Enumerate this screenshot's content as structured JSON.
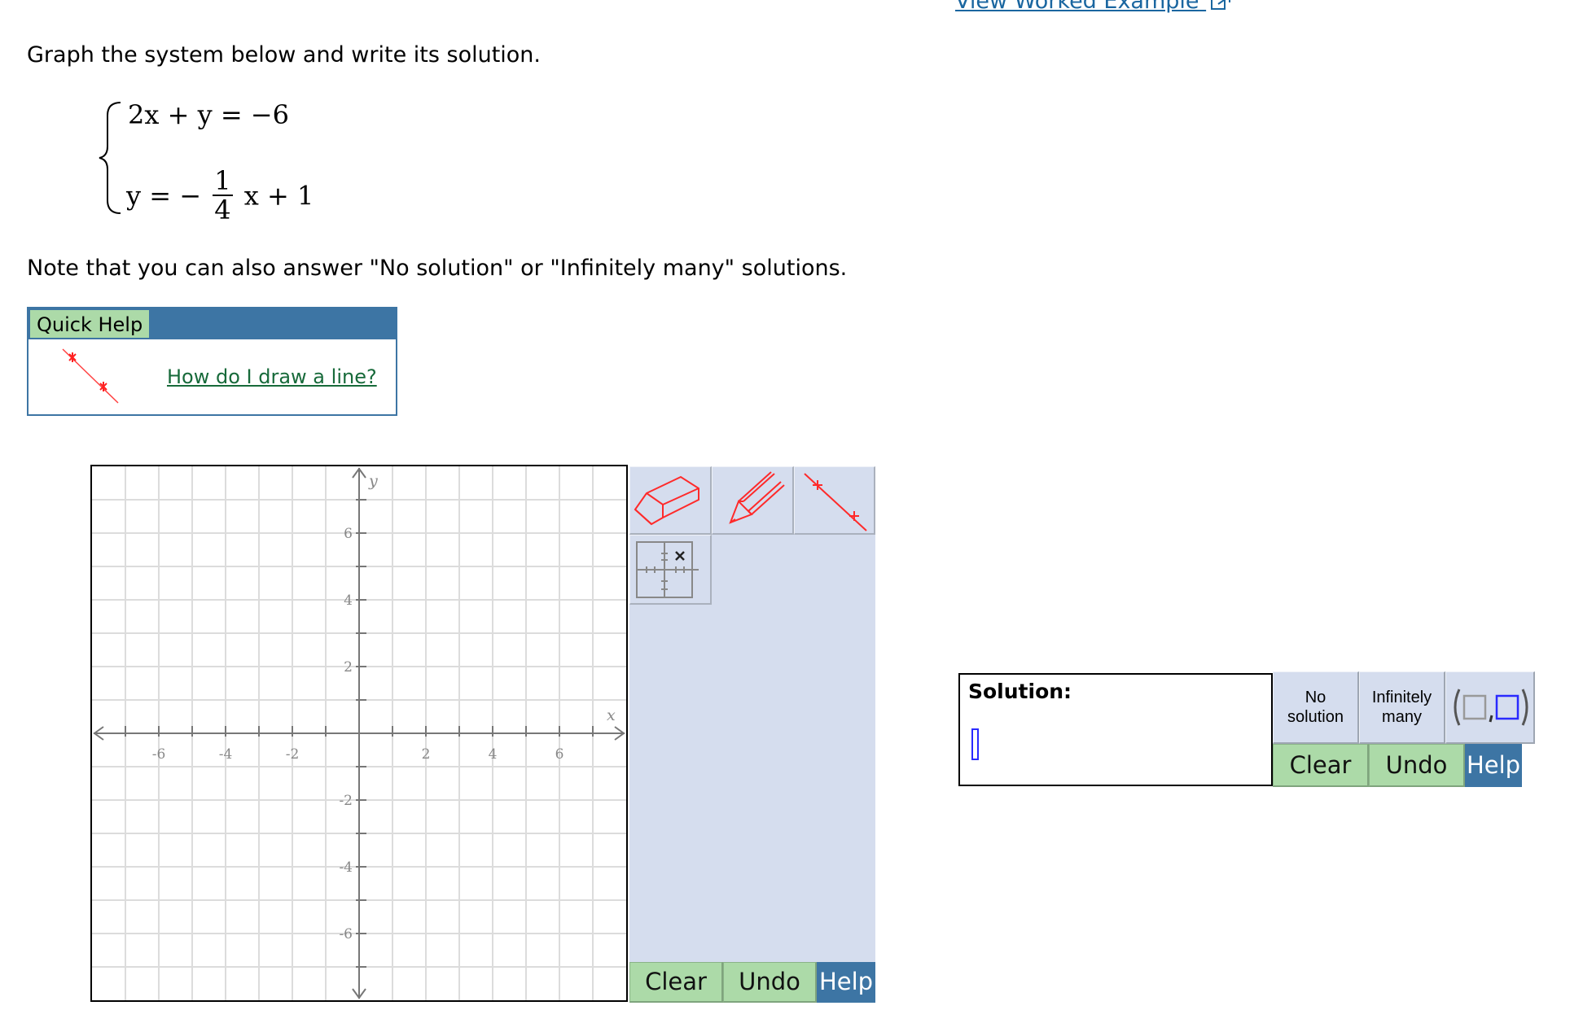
{
  "header": {
    "worked_example_link": "View Worked Example"
  },
  "problem": {
    "prompt": "Graph the system below and write its solution.",
    "equation1": {
      "lhs": "2x + y",
      "eq": "=",
      "rhs": "−6"
    },
    "equation2": {
      "lhs": "y",
      "eq": "=",
      "sign": "−",
      "frac_num": "1",
      "frac_den": "4",
      "tail": "x + 1"
    },
    "note": "Note that you can also answer \"No solution\" or \"Infinitely many\" solutions."
  },
  "quick_help": {
    "title": "Quick Help",
    "link": "How do I draw a line?",
    "icon": "line-tool-icon"
  },
  "graph": {
    "x_label": "x",
    "y_label": "y",
    "x_range": [
      -8,
      8
    ],
    "y_range": [
      -8,
      8
    ],
    "grid_step": 1,
    "x_tick_labels": [
      "-6",
      "-4",
      "-2",
      "2",
      "4",
      "6"
    ],
    "y_tick_labels": [
      "6",
      "4",
      "2",
      "-2",
      "-4",
      "-6"
    ],
    "x_tick_values": [
      -6,
      -4,
      -2,
      2,
      4,
      6
    ],
    "y_tick_values": [
      6,
      4,
      2,
      -2,
      -4,
      -6
    ]
  },
  "graph_tools": {
    "tools": [
      {
        "name": "eraser",
        "icon": "eraser-icon"
      },
      {
        "name": "pencil",
        "icon": "pencil-icon"
      },
      {
        "name": "line",
        "icon": "line-tool-icon"
      },
      {
        "name": "move-graph",
        "icon": "graph-move-icon"
      }
    ],
    "clear_label": "Clear",
    "undo_label": "Undo",
    "help_label": "Help"
  },
  "solution": {
    "title": "Solution:",
    "value": "",
    "no_solution_label_1": "No",
    "no_solution_label_2": "solution",
    "infinitely_label_1": "Infinitely",
    "infinitely_label_2": "many",
    "ordered_pair_icon": "ordered-pair-icon",
    "clear_label": "Clear",
    "undo_label": "Undo",
    "help_label": "Help"
  },
  "colors": {
    "accent_blue": "#3d75a4",
    "button_green": "#acdaa8",
    "tool_bg": "#d5ddee",
    "tool_red": "#ff2a2a",
    "link_green": "#176a3a",
    "link_blue": "#1a66a0"
  }
}
